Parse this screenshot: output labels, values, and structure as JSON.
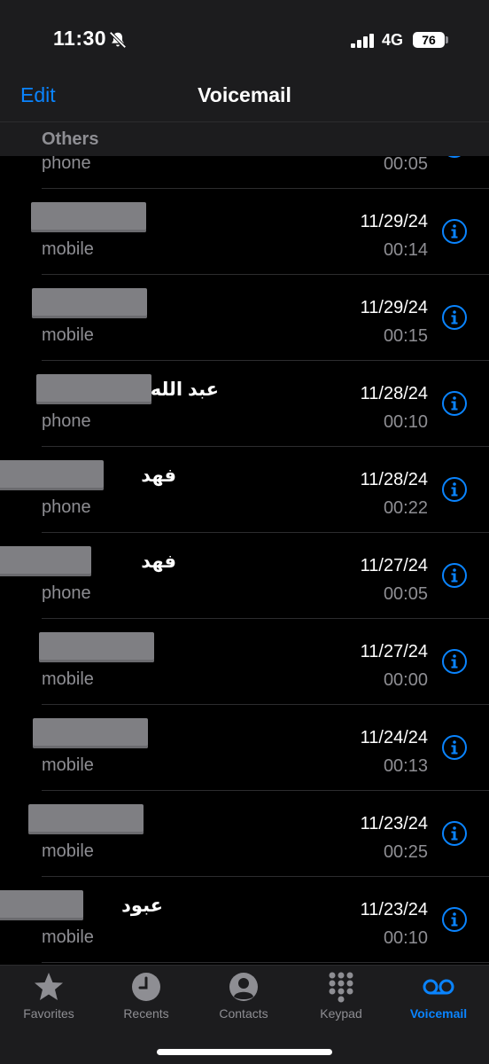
{
  "status": {
    "time": "11:30",
    "network": "4G",
    "battery": "76"
  },
  "nav": {
    "edit_label": "Edit",
    "title": "Voicemail"
  },
  "section": {
    "label": "Others"
  },
  "voicemails": [
    {
      "name": "",
      "type": "phone",
      "date": "",
      "duration": "00:05"
    },
    {
      "name": "",
      "type": "mobile",
      "date": "11/29/24",
      "duration": "00:14"
    },
    {
      "name": "",
      "type": "mobile",
      "date": "11/29/24",
      "duration": "00:15"
    },
    {
      "name": "عبد الله",
      "type": "phone",
      "date": "11/28/24",
      "duration": "00:10"
    },
    {
      "name": "فهد",
      "type": "phone",
      "date": "11/28/24",
      "duration": "00:22"
    },
    {
      "name": "فهد",
      "type": "phone",
      "date": "11/27/24",
      "duration": "00:05"
    },
    {
      "name": "",
      "type": "mobile",
      "date": "11/27/24",
      "duration": "00:00"
    },
    {
      "name": "",
      "type": "mobile",
      "date": "11/24/24",
      "duration": "00:13"
    },
    {
      "name": "",
      "type": "mobile",
      "date": "11/23/24",
      "duration": "00:25"
    },
    {
      "name": "عبود",
      "type": "mobile",
      "date": "11/23/24",
      "duration": "00:10"
    }
  ],
  "tabs": [
    {
      "label": "Favorites",
      "icon": "star-icon"
    },
    {
      "label": "Recents",
      "icon": "clock-icon"
    },
    {
      "label": "Contacts",
      "icon": "person-circle-icon"
    },
    {
      "label": "Keypad",
      "icon": "keypad-icon"
    },
    {
      "label": "Voicemail",
      "icon": "voicemail-icon"
    }
  ],
  "colors": {
    "accent": "#0a84ff",
    "secondary_text": "#8e8e93",
    "background": "#000000",
    "bar": "#1c1c1e"
  }
}
